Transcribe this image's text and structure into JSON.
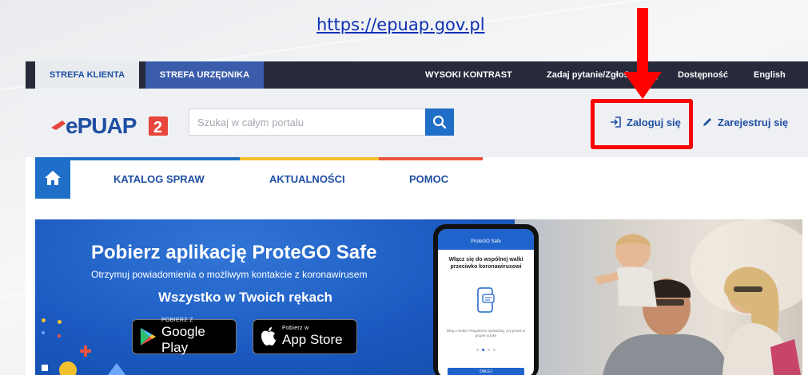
{
  "caption": {
    "url": "https://epuap.gov.pl"
  },
  "topbar": {
    "zone_tabs": [
      "STREFA KLIENTA",
      "STREFA URZĘDNIKA"
    ],
    "links": [
      "WYSOKI KONTRAST",
      "Zadaj pytanie/Zgłoś uwagę",
      "Dostępność",
      "English"
    ]
  },
  "header": {
    "logo": "ePUAP 2",
    "search": {
      "placeholder": "Szukaj w całym portalu",
      "value": ""
    },
    "login_label": "Zaloguj się",
    "register_label": "Zarejestruj się"
  },
  "nav": {
    "items": [
      "KATALOG SPRAW",
      "AKTUALNOŚCI",
      "POMOC"
    ]
  },
  "banner": {
    "title": "Pobierz aplikację ProteGO Safe",
    "subtitle": "Otrzymuj powiadomienia o możliwym kontakcie z koronawirusem",
    "slogan": "Wszystko w Twoich rękach",
    "google_play": {
      "small": "POBIERZ Z",
      "big": "Google Play"
    },
    "app_store": {
      "small": "Pobierz w",
      "big": "App Store"
    },
    "phone": {
      "app_title": "ProteGO Safe",
      "heading": "Włącz się do wspólnej walki przeciwko koronawirusowi",
      "small_text": "Dbaj o siebie! Regularnie sprawdzaj, czy jesteś w grupie ryzyka",
      "button": "DALEJ"
    }
  },
  "colors": {
    "topbar": "#262a3b",
    "brand_blue": "#1f4fa3",
    "action_blue": "#1f6ec7",
    "nav_blue": "#1f6ec7",
    "nav_yellow": "#f2c12e",
    "nav_red": "#e9543f",
    "highlight_red": "#ff0000"
  },
  "icons": {
    "search": "search-icon",
    "login": "login-icon",
    "register": "pencil-icon",
    "home": "home-icon",
    "google_play": "google-play-icon",
    "apple": "apple-icon"
  }
}
